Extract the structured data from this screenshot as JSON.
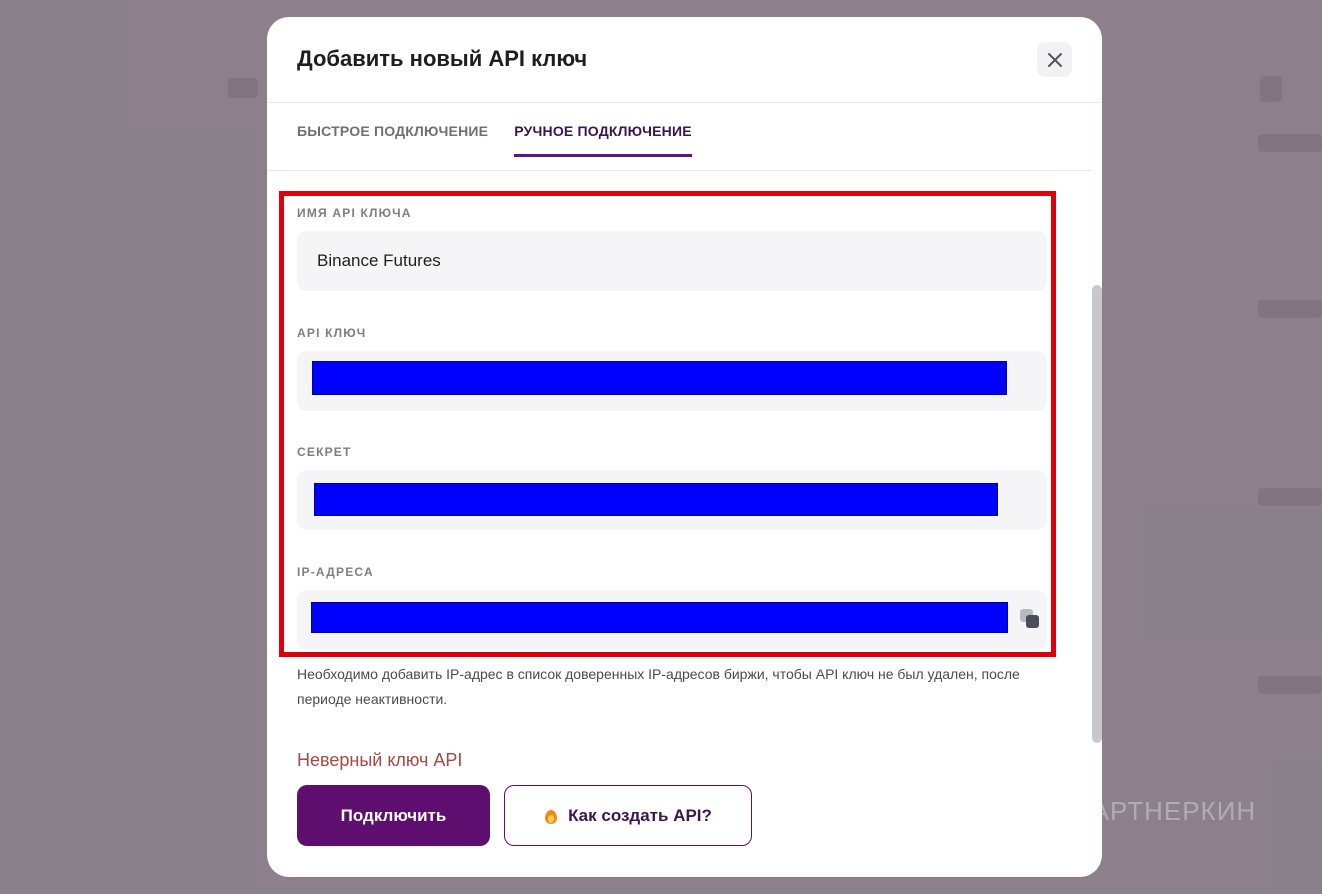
{
  "modal": {
    "title": "Добавить новый API ключ",
    "close_icon": "close-icon"
  },
  "tabs": [
    {
      "label": "БЫСТРОЕ ПОДКЛЮЧЕНИЕ",
      "active": false
    },
    {
      "label": "РУЧНОЕ ПОДКЛЮЧЕНИЕ",
      "active": true
    }
  ],
  "form": {
    "name_label": "ИМЯ API КЛЮЧА",
    "name_value": "Binance Futures",
    "key_label": "API КЛЮЧ",
    "secret_label": "СЕКРЕТ",
    "ip_label": "IP-АДРЕСА"
  },
  "hint": "Необходимо добавить IP-адрес в список доверенных IP-адресов биржи, чтобы API ключ не был удален, после периоде неактивности.",
  "error": "Неверный ключ API",
  "buttons": {
    "connect": "Подключить",
    "how_to": "Как создать API?"
  },
  "watermark": "ПАРТНЕРКИН",
  "colors": {
    "accent": "#5d0e6f",
    "error": "#a34a43",
    "redaction": "#0000ff",
    "highlight_frame": "#e0000a"
  }
}
